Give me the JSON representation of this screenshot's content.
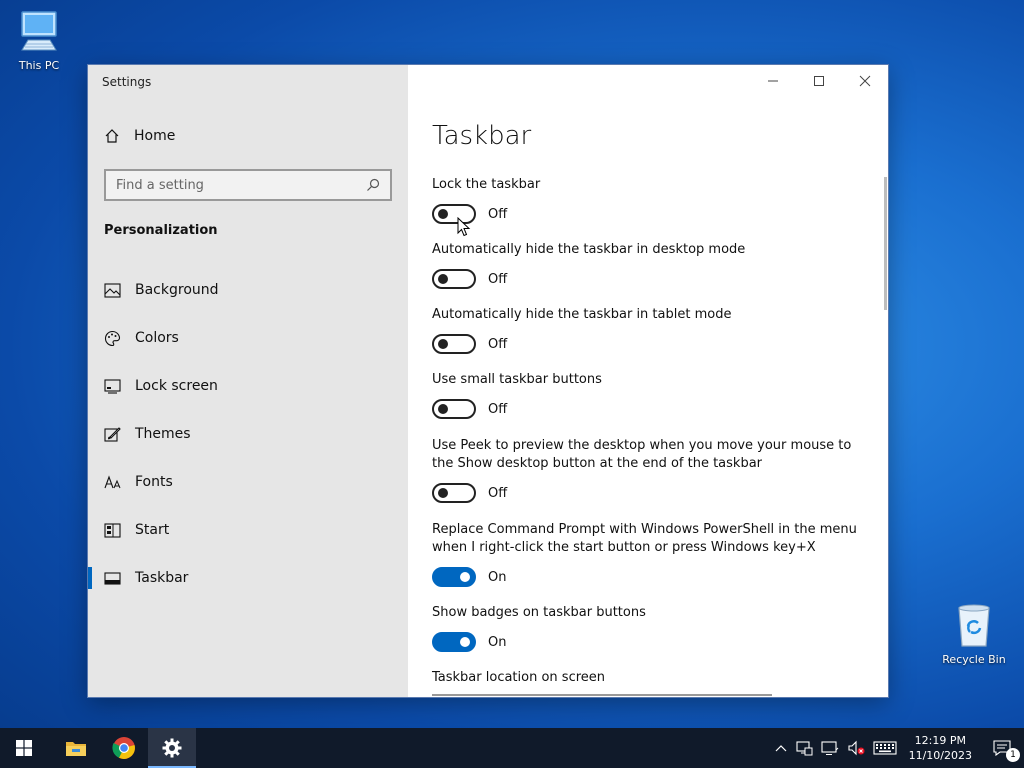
{
  "desktop": {
    "this_pc_label": "This PC",
    "recycle_bin_label": "Recycle Bin"
  },
  "window": {
    "title": "Settings",
    "controls": [
      "minimize-icon",
      "maximize-icon",
      "close-icon"
    ]
  },
  "nav": {
    "home_label": "Home",
    "search_placeholder": "Find a setting",
    "section_heading": "Personalization",
    "items": [
      {
        "label": "Background",
        "icon": "picture-icon"
      },
      {
        "label": "Colors",
        "icon": "palette-icon"
      },
      {
        "label": "Lock screen",
        "icon": "monitor-icon"
      },
      {
        "label": "Themes",
        "icon": "brush-icon"
      },
      {
        "label": "Fonts",
        "icon": "font-icon"
      },
      {
        "label": "Start",
        "icon": "start-icon"
      },
      {
        "label": "Taskbar",
        "icon": "taskbar-icon",
        "active": true
      }
    ]
  },
  "content": {
    "title": "Taskbar",
    "settings": [
      {
        "label": "Lock the taskbar",
        "state": "Off"
      },
      {
        "label": "Automatically hide the taskbar in desktop mode",
        "state": "Off"
      },
      {
        "label": "Automatically hide the taskbar in tablet mode",
        "state": "Off"
      },
      {
        "label": "Use small taskbar buttons",
        "state": "Off"
      },
      {
        "label": "Use Peek to preview the desktop when you move your mouse to the Show desktop button at the end of the taskbar",
        "state": "Off"
      },
      {
        "label": "Replace Command Prompt with Windows PowerShell in the menu when I right-click the start button or press Windows key+X",
        "state": "On"
      },
      {
        "label": "Show badges on taskbar buttons",
        "state": "On"
      }
    ],
    "location_label": "Taskbar location on screen"
  },
  "taskbar": {
    "apps": [
      "start-icon",
      "file-explorer-icon",
      "chrome-icon",
      "settings-icon"
    ],
    "tray_icons": [
      "chevron-up-icon",
      "network-icon",
      "display-icon",
      "volume-muted-icon",
      "keyboard-icon"
    ],
    "time": "12:19 PM",
    "date": "11/10/2023",
    "notification_count": "1"
  },
  "colors": {
    "accent": "#0067c0",
    "nav_bg": "#e6e6e6",
    "taskbar_bg": "#101a2a"
  }
}
